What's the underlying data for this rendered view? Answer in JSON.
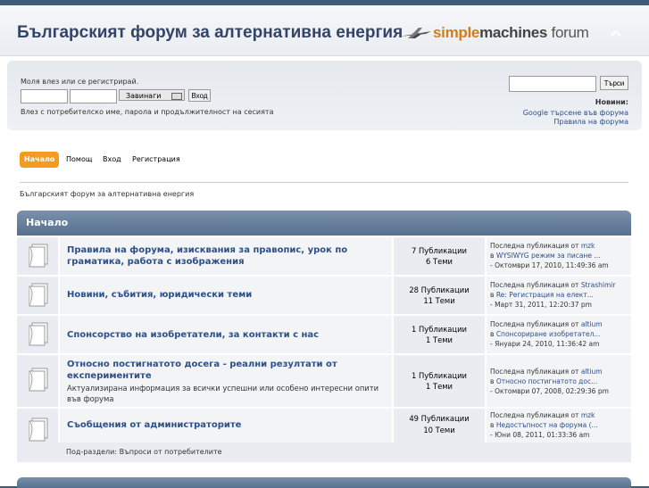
{
  "header": {
    "forum_title": "Българският форум за алтернативна енергия",
    "logo_simple": "simple",
    "logo_machines": "machines",
    "logo_forum": " forum"
  },
  "userbox": {
    "login_prompt": "Моля влез или се регистрирай.",
    "duration": "Завинаги",
    "login_button": "Вход",
    "login_hint": "Влез с потребителско име, парола и продължителност на сесията",
    "search_button": "Търси",
    "news_title": "Новини:",
    "news": [
      "Google търсене във форума",
      "Правила на форума"
    ]
  },
  "nav": {
    "items": [
      "Начало",
      "Помощ",
      "Вход",
      "Регистрация"
    ]
  },
  "breadcrumb": "Българският форум за алтернативна енергия",
  "category": {
    "title": "Начало"
  },
  "boards": [
    {
      "name": "Правила на форума, изисквания за правопис, урок по граматика, работа с изображения",
      "description": "",
      "posts": "7 Публикации",
      "topics": "6 Теми",
      "last_by_label": "Последна публикация от ",
      "last_by": "mzk",
      "last_in_label": "в ",
      "last_in": "WYSIWYG режим за писане ...",
      "last_date": "- Октомври 17, 2010, 11:49:36 am"
    },
    {
      "name": "Новини, събития, юридически теми",
      "description": "",
      "posts": "28 Публикации",
      "topics": "11 Теми",
      "last_by_label": "Последна публикация от ",
      "last_by": "Strashimir",
      "last_in_label": "в ",
      "last_in": "Re: Регистрация на елект...",
      "last_date": "- Март 31, 2011, 12:20:37 pm"
    },
    {
      "name": "Спонсорство на изобретатели, за контакти с нас",
      "description": "",
      "posts": "1 Публикации",
      "topics": "1 Теми",
      "last_by_label": "Последна публикация от ",
      "last_by": "altium",
      "last_in_label": "в ",
      "last_in": "Спонсориране изобретател...",
      "last_date": "- Януари 24, 2010, 11:36:42 am"
    },
    {
      "name": "Относно постигнатото досега - реални резултати от експериментите",
      "description": "Актуализирана информация за всички успешни или особено интересни опити във форума",
      "posts": "1 Публикации",
      "topics": "1 Теми",
      "last_by_label": "Последна публикация от ",
      "last_by": "altium",
      "last_in_label": "в ",
      "last_in": "Относно постигнатото дос...",
      "last_date": "- Октомври 07, 2008, 02:29:36 pm"
    },
    {
      "name": "Съобщения от администраторите",
      "description": "",
      "posts": "49 Публикации",
      "topics": "10 Теми",
      "last_by_label": "Последна публикация от ",
      "last_by": "mzk",
      "last_in_label": "в ",
      "last_in": "Недостъпност на форума (...",
      "last_date": "- Юни 08, 2011, 01:33:36 am"
    }
  ],
  "child_boards": {
    "label": "Под-раздели:",
    "items": [
      "Въпроси от потребителите"
    ]
  },
  "colors": {
    "accent": "#f39c1f",
    "link": "#2d4f8a",
    "category_header": "#56708f"
  }
}
